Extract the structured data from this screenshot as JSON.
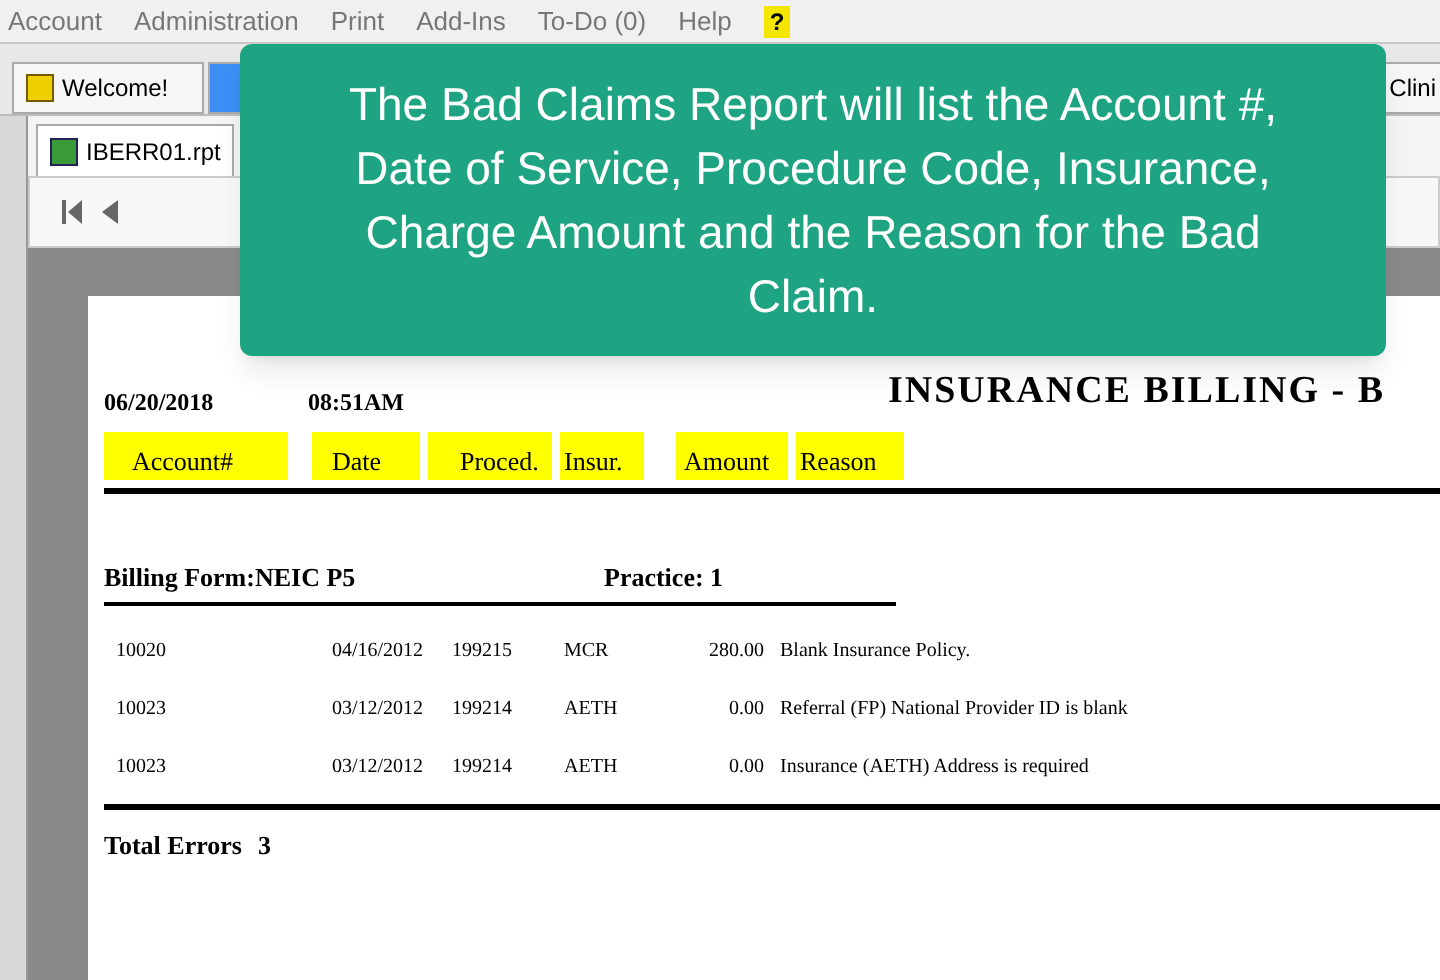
{
  "menu": {
    "items": [
      "Account",
      "Administration",
      "Print",
      "Add-Ins",
      "To-Do (0)",
      "Help"
    ],
    "help_badge": "?"
  },
  "tabs": [
    {
      "label": "Welcome!",
      "selected": false
    },
    {
      "selected": true
    },
    {
      "label": "Clini",
      "selected": false
    }
  ],
  "document": {
    "title": "IBERR01.rpt"
  },
  "report": {
    "date": "06/20/2018",
    "time": "08:51AM",
    "title": "INSURANCE BILLING - B",
    "columns": [
      "Account#",
      "Date",
      "Proced.",
      "Insur.",
      "Amount",
      "Reason"
    ],
    "billing_form": "Billing Form:NEIC P5",
    "practice": "Practice: 1",
    "rows": [
      [
        "10020",
        "04/16/2012",
        "199215",
        "MCR",
        "280.00",
        "Blank Insurance Policy."
      ],
      [
        "10023",
        "03/12/2012",
        "199214",
        "AETH",
        "0.00",
        "Referral (FP) National Provider ID is blank"
      ],
      [
        "10023",
        "03/12/2012",
        "199214",
        "AETH",
        "0.00",
        "Insurance (AETH) Address is required"
      ]
    ],
    "total_label": "Total Errors",
    "total_value": "3"
  },
  "callout": {
    "text": "The Bad Claims Report will list the Account #, Date of Service, Procedure Code, Insurance, Charge Amount and the Reason for the Bad Claim."
  }
}
